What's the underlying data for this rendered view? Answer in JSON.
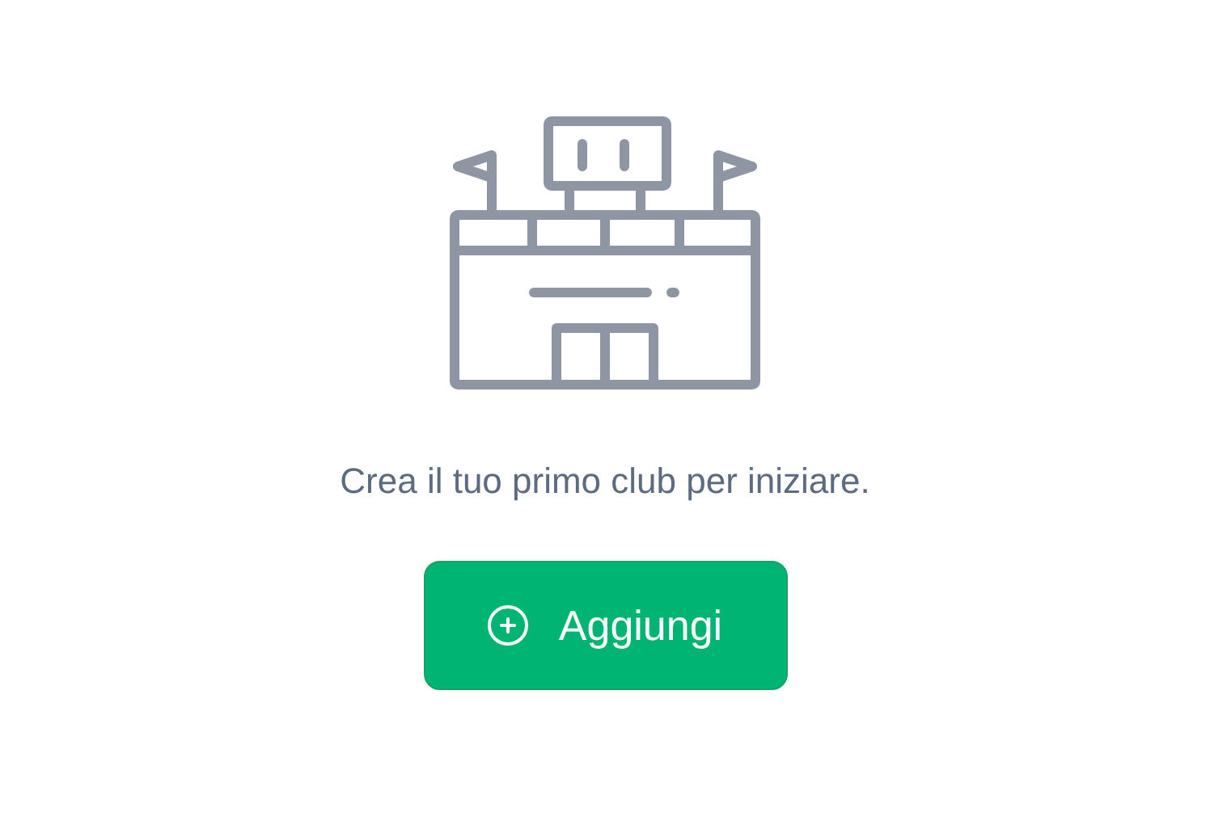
{
  "message": "Crea il tuo primo club per iniziare.",
  "button": {
    "label": "Aggiungi"
  }
}
